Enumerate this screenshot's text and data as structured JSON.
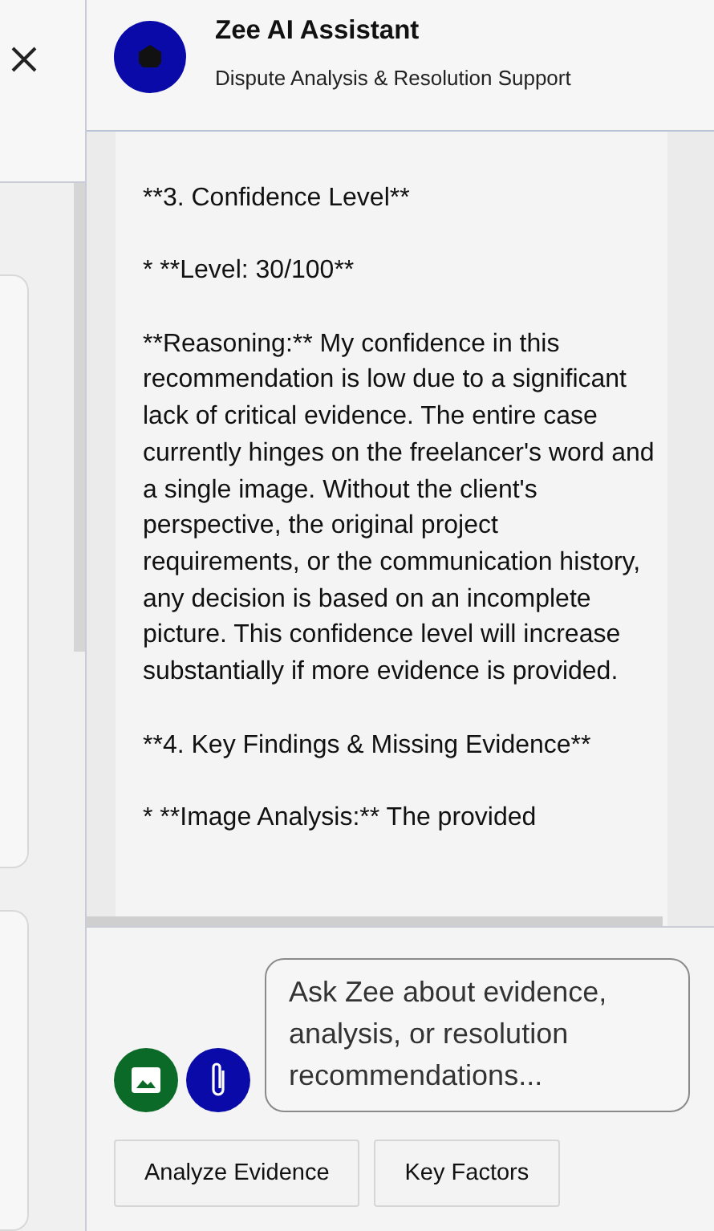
{
  "assistant": {
    "name": "Zee AI Assistant",
    "subtitle": "Dispute Analysis & Resolution Support"
  },
  "message": {
    "paragraphs": [
      "**3. Confidence Level**",
      "*   **Level: 30/100**",
      "**Reasoning:** My confidence in this recommendation is low due to a significant lack of critical evidence. The entire case currently hinges on the freelancer's word and a single image. Without the client's perspective, the original project requirements, or the communication history, any decision is based on an incomplete picture. This confidence level will increase substantially if more evidence is provided.",
      "**4. Key Findings & Missing Evidence**",
      "*   **Image Analysis:** The provided"
    ]
  },
  "composer": {
    "placeholder": "Ask Zee about evidence, analysis, or resolution recommendations..."
  },
  "quick_actions": [
    "Analyze Evidence",
    "Key Factors"
  ]
}
